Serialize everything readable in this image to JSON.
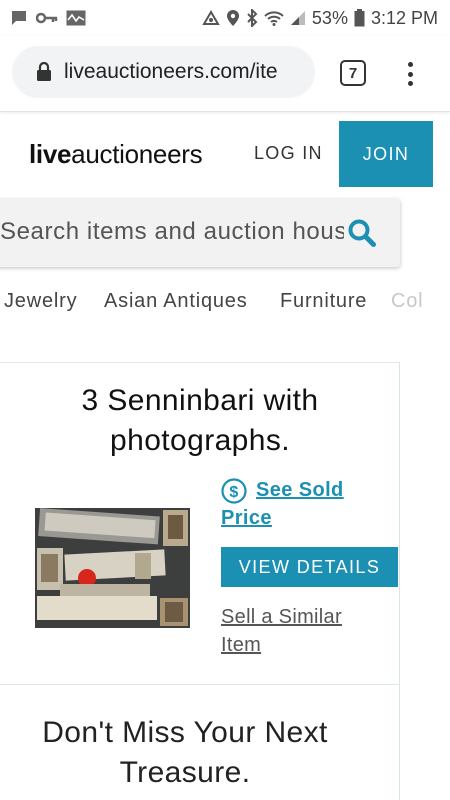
{
  "status_bar": {
    "battery": "53%",
    "time": "3:12 PM",
    "icons": [
      "chat-icon",
      "key-icon",
      "activity-icon",
      "nfc-icon",
      "location-icon",
      "bluetooth-icon",
      "wifi-icon",
      "signal-icon",
      "battery-icon"
    ]
  },
  "browser": {
    "url": "liveauctioneers.com/ite",
    "tab_count": "7"
  },
  "header": {
    "logo_bold": "live",
    "logo_rest": "auctioneers",
    "login_label": "LOG IN",
    "join_label": "JOIN"
  },
  "search": {
    "placeholder": "Search items and auction hous"
  },
  "categories": [
    "Jewelry",
    "Asian Antiques",
    "Furniture",
    "Col"
  ],
  "item": {
    "title_line1": "3 Senninbari with",
    "title_line2": "photographs.",
    "see_sold_line1": "See Sold",
    "see_sold_line2": "Price",
    "view_details_label": "VIEW DETAILS",
    "sell_similar_line1": "Sell a Similar",
    "sell_similar_line2": "Item"
  },
  "promo": {
    "line1": "Don't Miss Your Next",
    "line2": "Treasure."
  },
  "colors": {
    "accent": "#1b90b3",
    "text": "#222222"
  }
}
